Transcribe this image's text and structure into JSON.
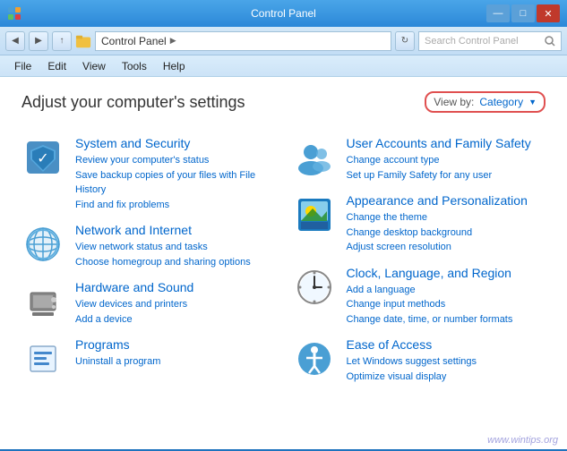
{
  "titlebar": {
    "title": "Control Panel",
    "min_label": "—",
    "max_label": "□",
    "close_label": "✕"
  },
  "addressbar": {
    "back_label": "◀",
    "forward_label": "▶",
    "up_label": "↑",
    "address": "Control Panel",
    "arrow": "▶",
    "search_placeholder": "Search Control Panel",
    "refresh_label": "↻"
  },
  "menubar": {
    "items": [
      "File",
      "Edit",
      "View",
      "Tools",
      "Help"
    ]
  },
  "header": {
    "title": "Adjust your computer's settings",
    "viewby_label": "View by:",
    "viewby_value": "Category"
  },
  "left_panels": [
    {
      "id": "system-security",
      "title": "System and Security",
      "links": [
        "Review your computer's status",
        "Save backup copies of your files with File History",
        "Find and fix problems"
      ]
    },
    {
      "id": "network-internet",
      "title": "Network and Internet",
      "links": [
        "View network status and tasks",
        "Choose homegroup and sharing options"
      ]
    },
    {
      "id": "hardware-sound",
      "title": "Hardware and Sound",
      "links": [
        "View devices and printers",
        "Add a device"
      ]
    },
    {
      "id": "programs",
      "title": "Programs",
      "links": [
        "Uninstall a program"
      ]
    }
  ],
  "right_panels": [
    {
      "id": "user-accounts",
      "title": "User Accounts and Family Safety",
      "links": [
        "Change account type",
        "Set up Family Safety for any user"
      ]
    },
    {
      "id": "appearance",
      "title": "Appearance and Personalization",
      "links": [
        "Change the theme",
        "Change desktop background",
        "Adjust screen resolution"
      ]
    },
    {
      "id": "clock-language",
      "title": "Clock, Language, and Region",
      "links": [
        "Add a language",
        "Change input methods",
        "Change date, time, or number formats"
      ]
    },
    {
      "id": "ease-access",
      "title": "Ease of Access",
      "links": [
        "Let Windows suggest settings",
        "Optimize visual display"
      ]
    }
  ],
  "watermark": "www.wintips.org"
}
